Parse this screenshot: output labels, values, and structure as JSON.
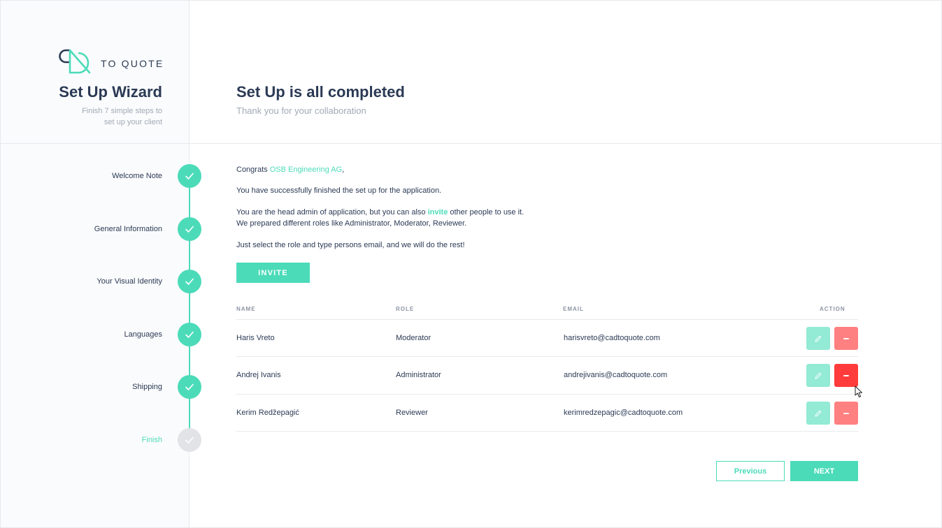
{
  "brand": {
    "logo_text": "TO QUOTE",
    "accent": "#4cdbb9",
    "danger": "#ff8080",
    "danger_hover": "#ff3b3b"
  },
  "sidebar": {
    "title": "Set Up Wizard",
    "subtitle_line1": "Finish 7 simple steps to",
    "subtitle_line2": "set up your client",
    "steps": [
      {
        "label": "Welcome Note",
        "status": "done"
      },
      {
        "label": "General Information",
        "status": "done"
      },
      {
        "label": "Your Visual Identity",
        "status": "done"
      },
      {
        "label": "Languages",
        "status": "done"
      },
      {
        "label": "Shipping",
        "status": "done"
      },
      {
        "label": "Finish",
        "status": "current"
      }
    ]
  },
  "main": {
    "title": "Set Up is all completed",
    "subtitle": "Thank you for your collaboration",
    "congrats_prefix": "Congrats ",
    "company": "OSB Engineering AG",
    "congrats_suffix": ",",
    "success_text": "You have successfully finished the set up for the application.",
    "admin_prefix": "You are the head admin of application, but you can also ",
    "admin_link": "invite",
    "admin_suffix": " other people to use it.",
    "roles_text": "We prepared different roles like Administrator, Moderator, Reviewer.",
    "instruction_text": "Just select the role and type persons email, and we will do the rest!",
    "invite_label": "INVITE"
  },
  "table": {
    "headers": {
      "name": "NAME",
      "role": "ROLE",
      "email": "EMAIL",
      "action": "ACTION"
    },
    "rows": [
      {
        "name": "Haris Vreto",
        "role": "Moderator",
        "email": "harisvreto@cadtoquote.com"
      },
      {
        "name": "Andrej Ivanis",
        "role": "Administrator",
        "email": "andrejivanis@cadtoquote.com"
      },
      {
        "name": "Kerim Redžepagić",
        "role": "Reviewer",
        "email": "kerimredzepagic@cadtoquote.com"
      }
    ]
  },
  "footer": {
    "previous_label": "Previous",
    "next_label": "NEXT"
  },
  "icons": [
    "logo-icon",
    "check-icon",
    "pencil-icon",
    "minus-icon",
    "cursor-icon"
  ]
}
